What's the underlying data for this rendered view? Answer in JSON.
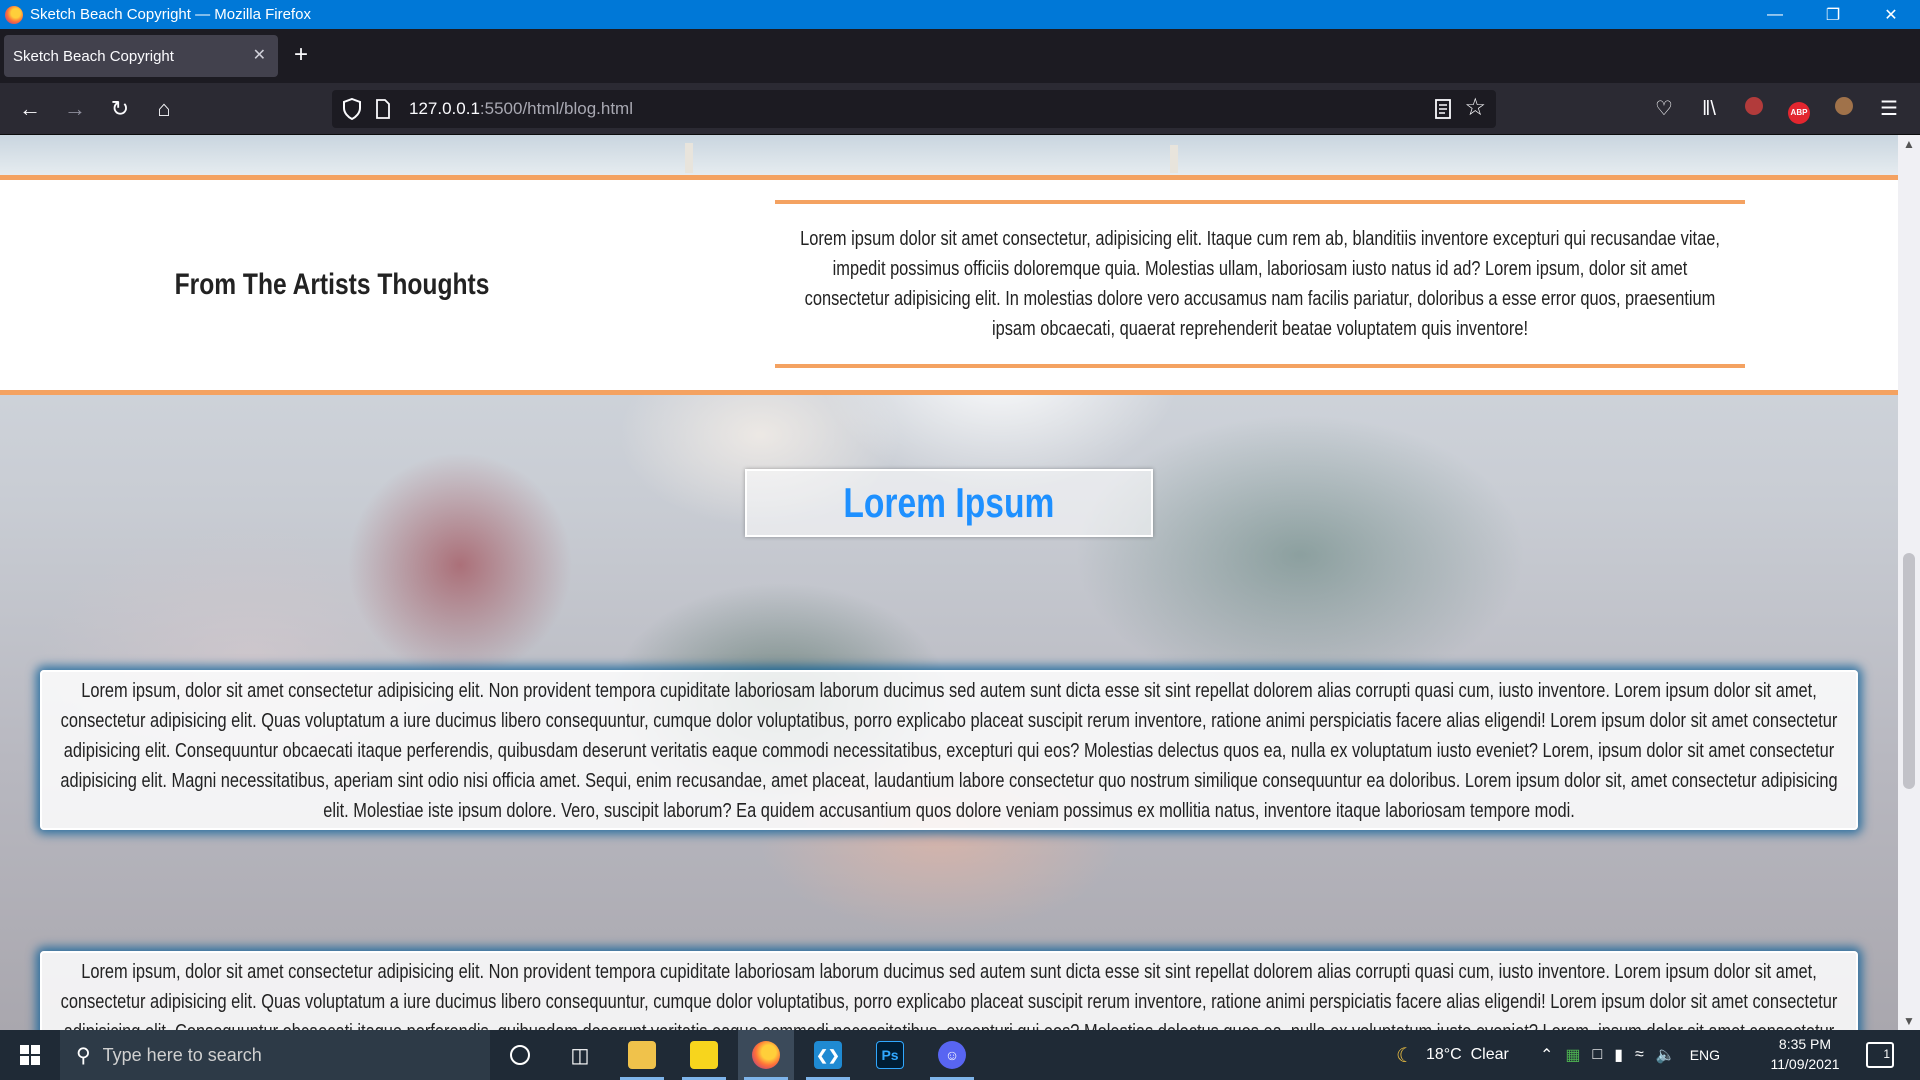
{
  "window": {
    "title": "Sketch Beach Copyright — Mozilla Firefox"
  },
  "tabs": [
    {
      "label": "Sketch Beach Copyright",
      "active": true
    }
  ],
  "urlbar": {
    "host": "127.0.0.1",
    "path": ":5500/html/blog.html"
  },
  "page": {
    "artist_heading": "From The Artists Thoughts",
    "artist_text": "Lorem ipsum dolor sit amet consectetur, adipisicing elit. Itaque cum rem ab, blanditiis inventore excepturi qui recusandae vitae, impedit possimus officiis doloremque quia. Molestias ullam, laboriosam iusto natus id ad? Lorem ipsum, dolor sit amet consectetur adipisicing elit. In molestias dolore vero accusamus nam facilis pariatur, doloribus a esse error quos, praesentium ipsam obcaecati, quaerat reprehenderit beatae voluptatem quis inventore!",
    "section_title": "Lorem Ipsum",
    "paragraph_1": "Lorem ipsum, dolor sit amet consectetur adipisicing elit. Non provident tempora cupiditate laboriosam laborum ducimus sed autem sunt dicta esse sit sint repellat dolorem alias corrupti quasi cum, iusto inventore. Lorem ipsum dolor sit amet, consectetur adipisicing elit. Quas voluptatum a iure ducimus libero consequuntur, cumque dolor voluptatibus, porro explicabo placeat suscipit rerum inventore, ratione animi perspiciatis facere alias eligendi! Lorem ipsum dolor sit amet consectetur adipisicing elit. Consequuntur obcaecati itaque perferendis, quibusdam deserunt veritatis eaque commodi necessitatibus, excepturi qui eos? Molestias delectus quos ea, nulla ex voluptatum iusto eveniet? Lorem, ipsum dolor sit amet consectetur adipisicing elit. Magni necessitatibus, aperiam sint odio nisi officia amet. Sequi, enim recusandae, amet placeat, laudantium labore consectetur quo nostrum similique consequuntur ea doloribus. Lorem ipsum dolor sit, amet consectetur adipisicing elit. Molestiae iste ipsum dolore. Vero, suscipit laborum? Ea quidem accusantium quos dolore veniam possimus ex mollitia natus, inventore itaque laboriosam tempore modi.",
    "paragraph_2": "Lorem ipsum, dolor sit amet consectetur adipisicing elit. Non provident tempora cupiditate laboriosam laborum ducimus sed autem sunt dicta esse sit sint repellat dolorem alias corrupti quasi cum, iusto inventore. Lorem ipsum dolor sit amet, consectetur adipisicing elit. Quas voluptatum a iure ducimus libero consequuntur, cumque dolor voluptatibus, porro explicabo placeat suscipit rerum inventore, ratione animi perspiciatis facere alias eligendi! Lorem ipsum dolor sit amet consectetur adipisicing elit. Consequuntur obcaecati itaque perferendis, quibusdam deserunt veritatis eaque commodi necessitatibus, excepturi qui eos? Molestias delectus quos ea, nulla ex voluptatum iusto eveniet? Lorem, ipsum dolor sit amet consectetur"
  },
  "taskbar": {
    "search_placeholder": "Type here to search",
    "apps": [
      "task-view",
      "file-explorer",
      "sticky-notes",
      "firefox",
      "vscode",
      "photoshop",
      "discord"
    ],
    "weather_icon": "moon-icon",
    "weather": "18°C  Clear",
    "language": "ENG",
    "time": "8:35 PM",
    "date": "11/09/2021",
    "notifications": "1"
  },
  "colors": {
    "accent_orange": "#f4a261",
    "title_blue": "#1e90ff",
    "card_glow": "#005a96",
    "titlebar": "#0078d7"
  }
}
